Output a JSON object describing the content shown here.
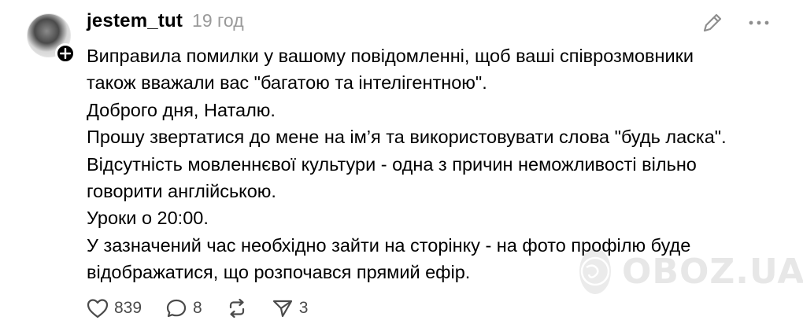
{
  "post": {
    "username": "jestem_tut",
    "timestamp": "19 год",
    "lines": [
      "Виправила помилки у вашому повідомленні, щоб ваші співрозмовники",
      "також вважали вас \"багатою та інтелігентною\".",
      "Доброго дня, Наталю.",
      "Прошу звертатися до мене на ім’я та використовувати слова \"будь ласка\".",
      "Відсутність мовленнєвої культури - одна з причин неможливості вільно",
      "говорити англійською.",
      "Уроки о 20:00.",
      "У зазначений час необхідно зайти на сторінку - на фото профілю буде",
      "відображатися, що розпочався прямий ефір."
    ]
  },
  "actions": {
    "likes": "839",
    "comments": "8",
    "shares": "3"
  },
  "icons": {
    "avatar": "avatar",
    "follow": "plus-icon",
    "edit": "pencil-icon",
    "more": "more-dots-icon",
    "like": "heart-icon",
    "comment": "comment-bubble-icon",
    "repost": "repost-icon",
    "share": "send-icon"
  },
  "watermark": {
    "text": "OBOZ.UA"
  }
}
